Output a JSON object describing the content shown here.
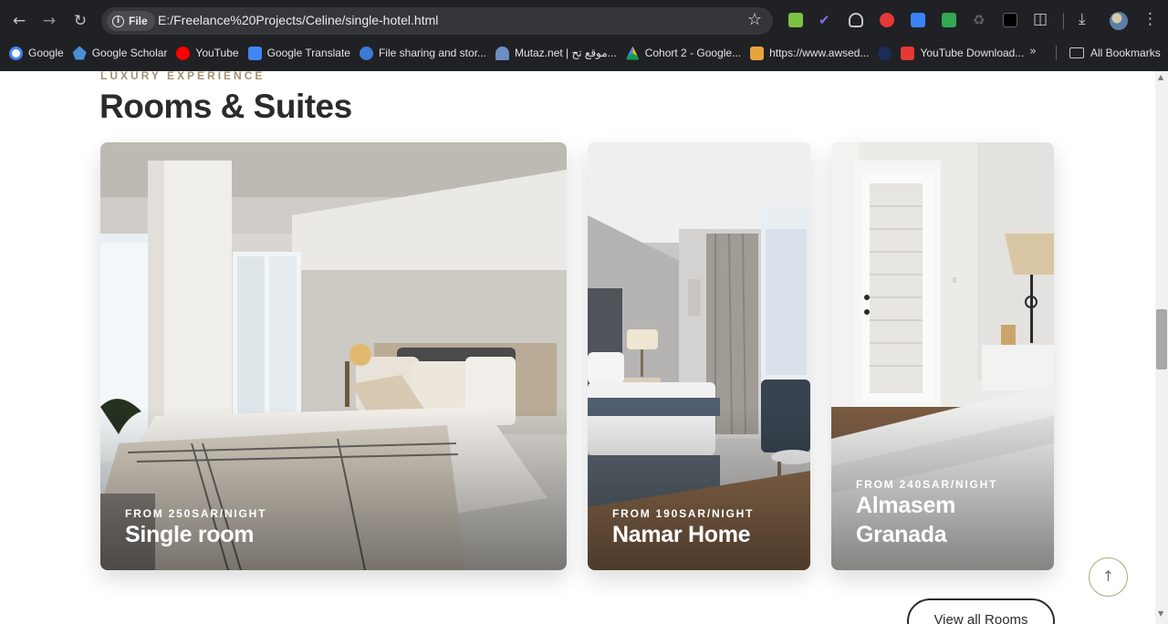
{
  "browser": {
    "chip_label": "File",
    "url": "E:/Freelance%20Projects/Celine/single-hotel.html",
    "bookmarks": [
      {
        "label": "Google",
        "color": "#4285f4"
      },
      {
        "label": "Google Scholar",
        "color": "#4a90d9"
      },
      {
        "label": "YouTube",
        "color": "#ff0000"
      },
      {
        "label": "Google Translate",
        "color": "#4285f4"
      },
      {
        "label": "File sharing and stor...",
        "color": "#3a7bd5"
      },
      {
        "label": "Mutaz.net | موقع تح...",
        "color": "#6b8fc4"
      },
      {
        "label": "Cohort 2 - Google...",
        "color": "#0f9d58"
      },
      {
        "label": "https://www.awsed...",
        "color": "#e8a33d"
      },
      {
        "label": "",
        "color": "#1c2c5b"
      },
      {
        "label": "YouTube Download...",
        "color": "#e53935"
      }
    ],
    "more_label": "»",
    "all_bookmarks_label": "All Bookmarks"
  },
  "section": {
    "eyebrow": "LUXURY EXPERIENCE",
    "title": "Rooms & Suites"
  },
  "rooms": [
    {
      "price": "FROM 250SAR/NIGHT",
      "title": "Single room"
    },
    {
      "price": "FROM 190SAR/NIGHT",
      "title": "Namar Home"
    },
    {
      "price": "FROM 240SAR/NIGHT",
      "title": "Almasem Granada"
    }
  ],
  "view_all_label": "View all Rooms",
  "scroll_top_icon": "arrow-up-icon",
  "colors": {
    "accent": "#a3916e",
    "heading": "#2b2b2b",
    "chrome_bg": "#202124"
  }
}
